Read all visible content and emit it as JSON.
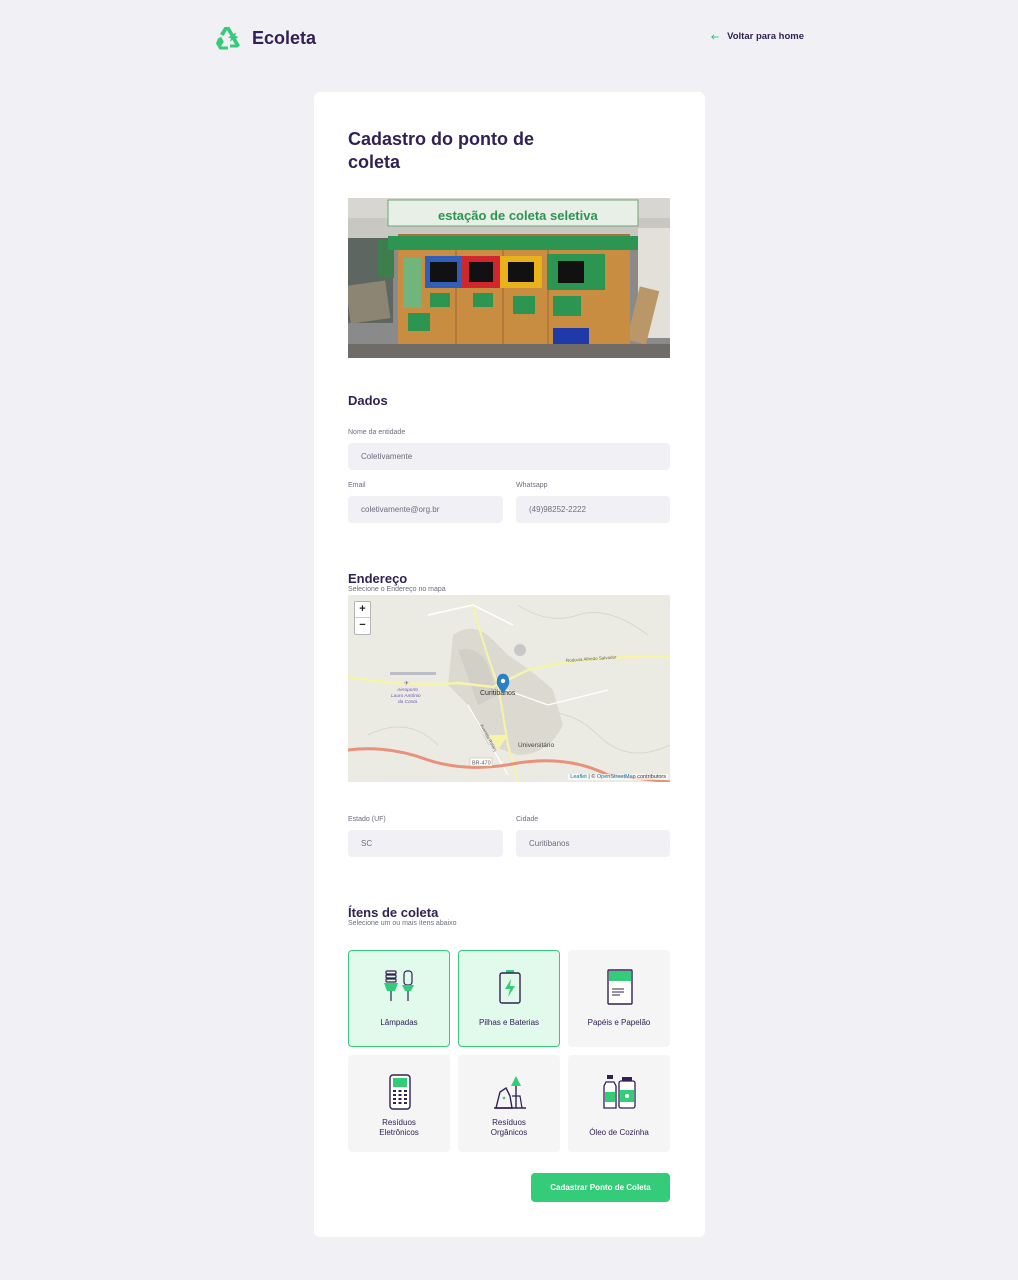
{
  "header": {
    "brand": "Ecoleta",
    "back_label": "Voltar para home",
    "brand_color": "#34cb79"
  },
  "form": {
    "title": "Cadastro do ponto de coleta",
    "photo": {
      "sign_text": "estação de coleta seletiva"
    },
    "dados": {
      "title": "Dados",
      "name_label": "Nome da entidade",
      "name_value": "Coletivamente",
      "email_label": "Email",
      "email_value": "coletivamente@org.br",
      "whatsapp_label": "Whatsapp",
      "whatsapp_value": "(49)98252-2222"
    },
    "endereco": {
      "title": "Endereço",
      "subtitle": "Selecione o Endereço no mapa",
      "map": {
        "zoom_in": "+",
        "zoom_out": "−",
        "city_label": "Curitibanos",
        "district_label": "Universitário",
        "airport_label_1": "Aeroporto",
        "airport_label_2": "Lauro Antônio",
        "airport_label_3": "da Costa",
        "highway_label": "BR-470",
        "road_label": "Rodovia Alfredo Salvador",
        "road_label_2": "Avenida Rotary",
        "attrib_link_1": "Leaflet",
        "attrib_text": "| ©",
        "attrib_link_2": "OpenStreetMap",
        "attrib_text_2": "contributors"
      },
      "uf_label": "Estado (UF)",
      "uf_value": "SC",
      "city_label": "Cidade",
      "city_value": "Curitibanos"
    },
    "itens": {
      "title": "Ítens de coleta",
      "subtitle": "Selecione um ou mais ítens abaixo",
      "list": [
        {
          "label": "Lâmpadas",
          "icon": "lamp-icon",
          "selected": true
        },
        {
          "label": "Pilhas e Baterias",
          "icon": "battery-icon",
          "selected": true
        },
        {
          "label": "Papéis e Papelão",
          "icon": "paper-icon",
          "selected": false
        },
        {
          "label_1": "Resíduos",
          "label_2": "Eletrônicos",
          "icon": "electronics-icon",
          "selected": false
        },
        {
          "label_1": "Resíduos",
          "label_2": "Orgânicos",
          "icon": "organic-icon",
          "selected": false
        },
        {
          "label": "Óleo de Cozinha",
          "icon": "oil-icon",
          "selected": false
        }
      ]
    },
    "submit_label": "Cadastrar Ponto de Coleta"
  }
}
